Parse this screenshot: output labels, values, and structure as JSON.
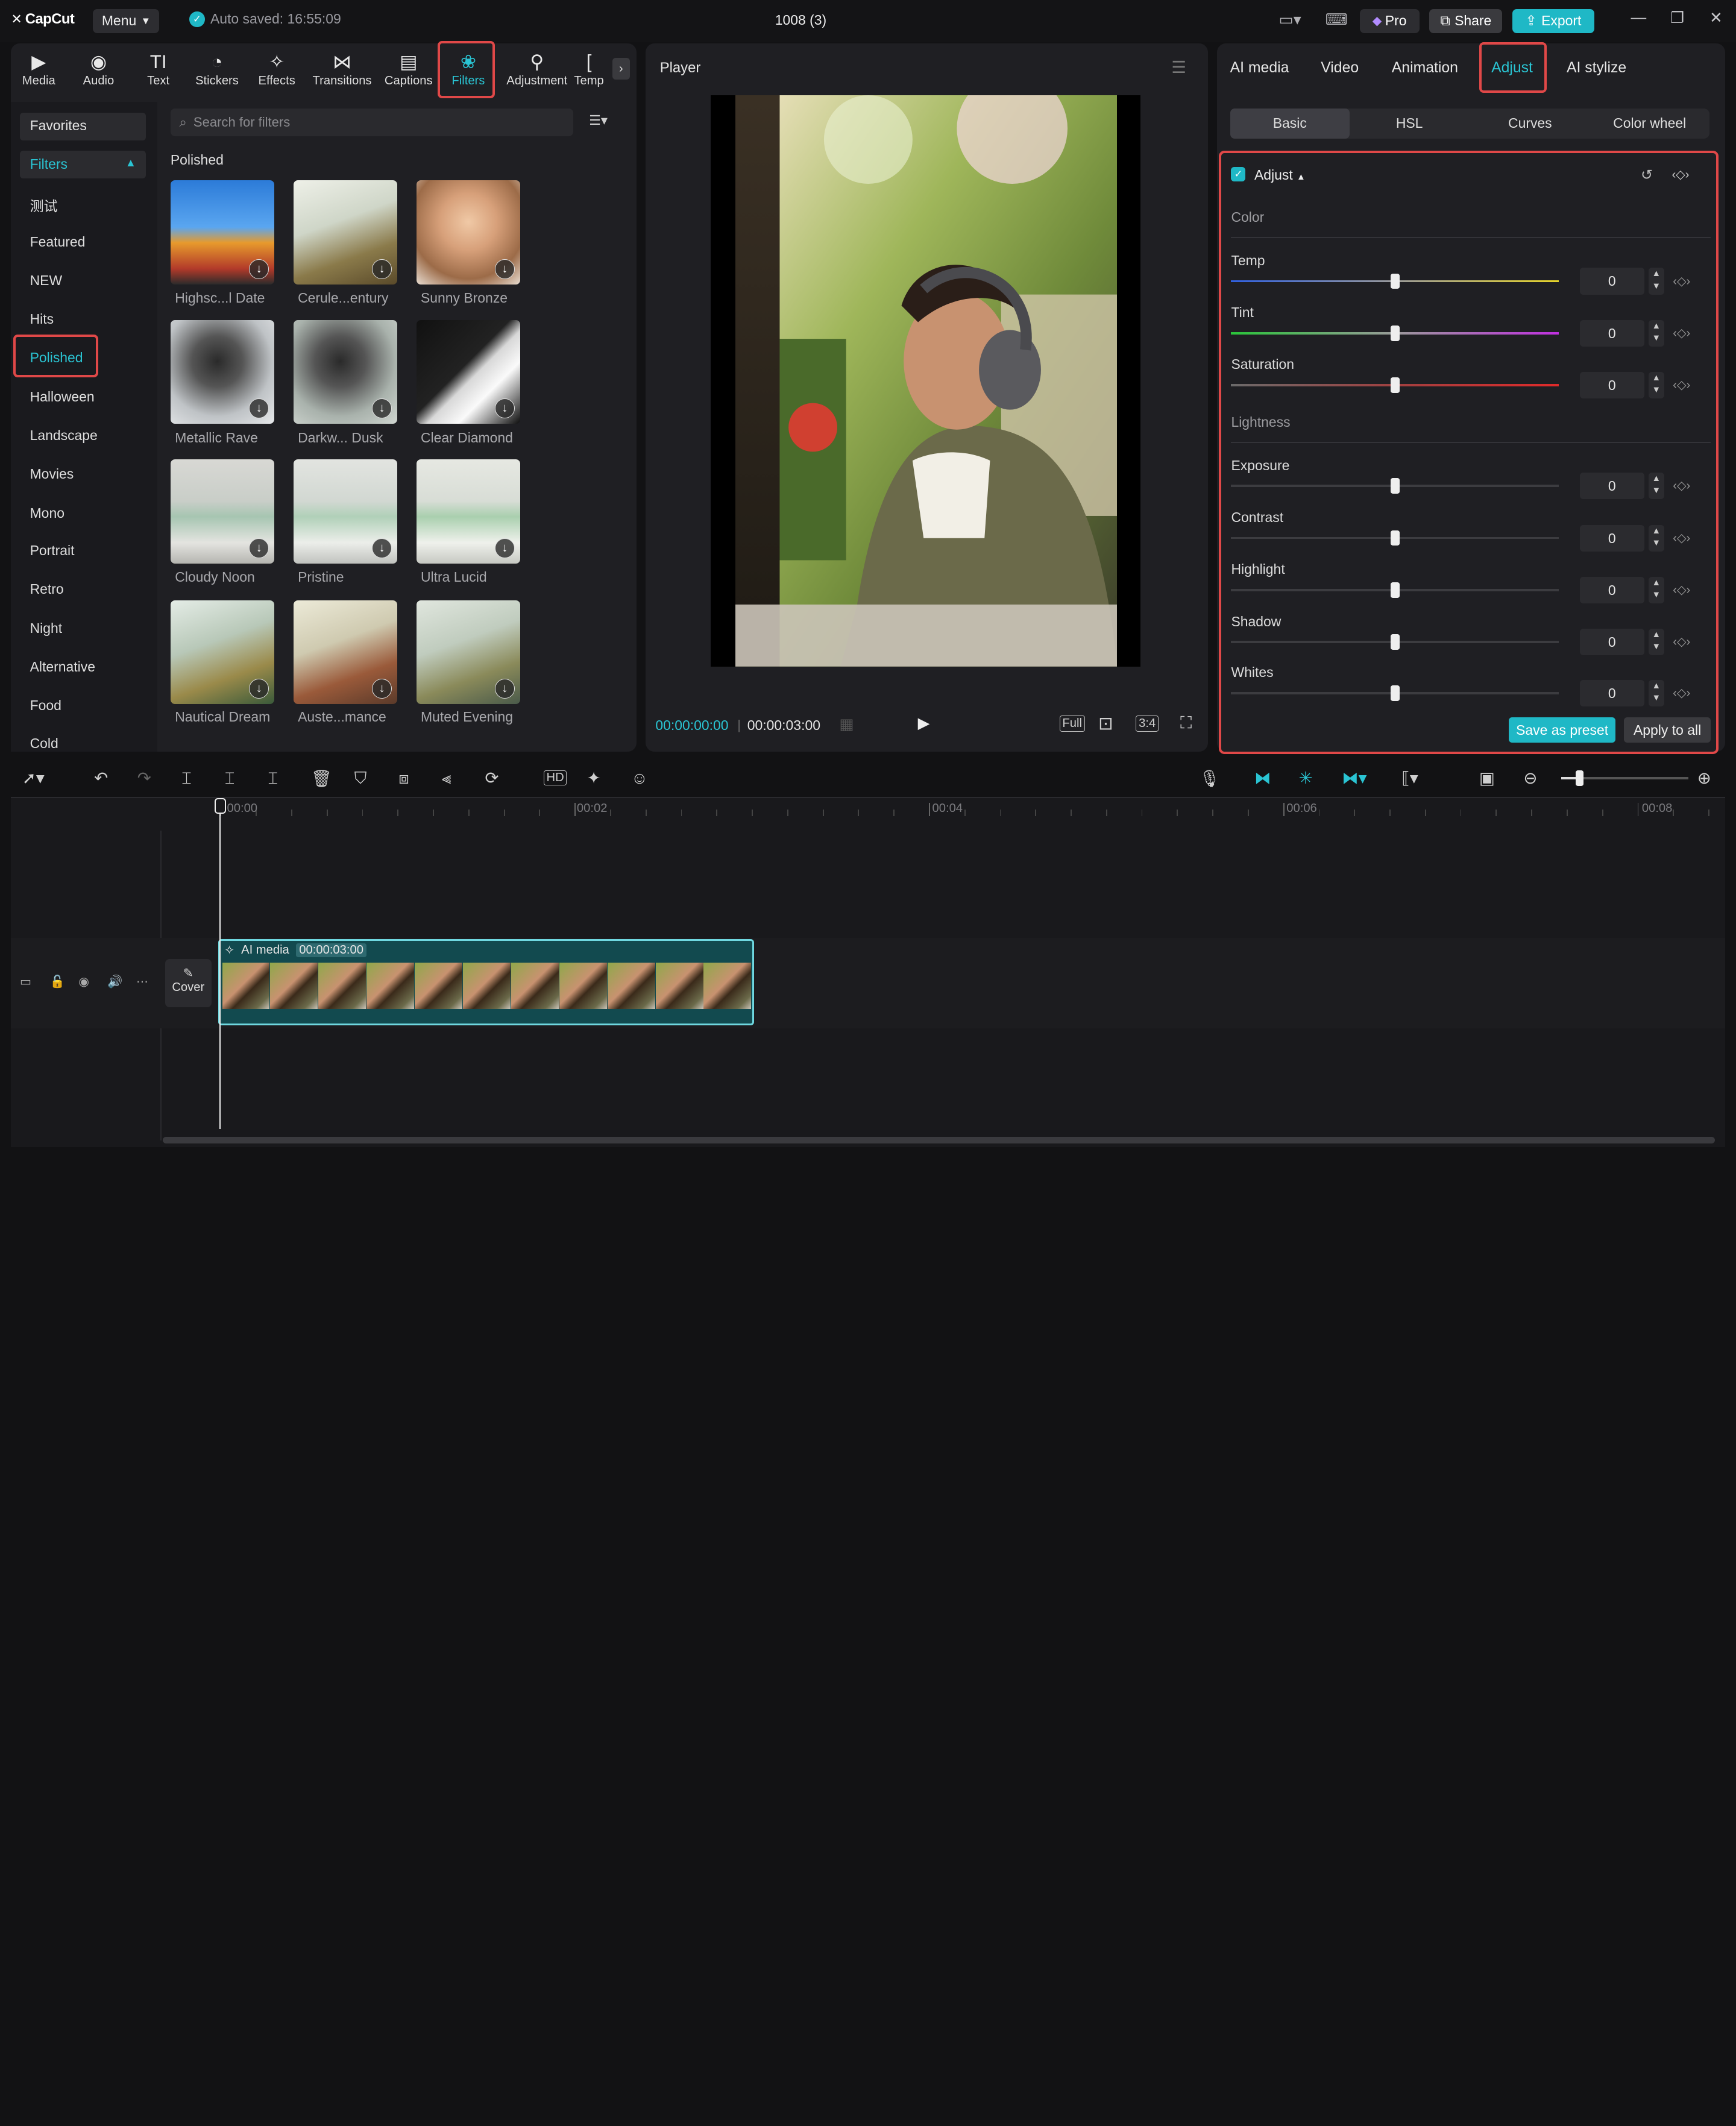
{
  "titlebar": {
    "brand": "CapCut",
    "menu": "Menu",
    "autosave": "Auto saved: 16:55:09",
    "doc_title": "1008 (3)",
    "pro": "Pro",
    "share": "Share",
    "export": "Export"
  },
  "media_tabs": [
    {
      "label": "Media",
      "icon": "media-icon"
    },
    {
      "label": "Audio",
      "icon": "audio-icon"
    },
    {
      "label": "Text",
      "icon": "text-icon"
    },
    {
      "label": "Stickers",
      "icon": "stickers-icon"
    },
    {
      "label": "Effects",
      "icon": "effects-icon"
    },
    {
      "label": "Transitions",
      "icon": "transitions-icon"
    },
    {
      "label": "Captions",
      "icon": "captions-icon"
    },
    {
      "label": "Filters",
      "icon": "filters-icon"
    },
    {
      "label": "Adjustment",
      "icon": "adjustment-icon"
    },
    {
      "label": "Temp",
      "icon": "template-icon"
    }
  ],
  "sidebar": {
    "favorites": "Favorites",
    "filters": "Filters",
    "items": [
      "测试",
      "Featured",
      "NEW",
      "Hits",
      "Polished",
      "Halloween",
      "Landscape",
      "Movies",
      "Mono",
      "Portrait",
      "Retro",
      "Night",
      "Alternative",
      "Food",
      "Cold"
    ]
  },
  "search": {
    "placeholder": "Search for filters"
  },
  "section_title": "Polished",
  "filters": [
    "Highsc...l Date",
    "Cerule...entury",
    "Sunny Bronze",
    "Metallic Rave",
    "Darkw... Dusk",
    "Clear Diamond",
    "Cloudy Noon",
    "Pristine",
    "Ultra Lucid",
    "Nautical Dream",
    "Auste...mance",
    "Muted Evening"
  ],
  "player": {
    "title": "Player",
    "current_time": "00:00:00:00",
    "duration": "00:00:03:00",
    "full": "Full",
    "ratio": "3:4"
  },
  "right_tabs": [
    "AI media",
    "Video",
    "Animation",
    "Adjust",
    "AI stylize"
  ],
  "sub_tabs": [
    "Basic",
    "HSL",
    "Curves",
    "Color wheel"
  ],
  "adjust": {
    "title": "Adjust",
    "color_group": "Color",
    "lightness_group": "Lightness",
    "color_params": [
      {
        "label": "Temp",
        "value": "0"
      },
      {
        "label": "Tint",
        "value": "0"
      },
      {
        "label": "Saturation",
        "value": "0"
      }
    ],
    "lightness_params": [
      {
        "label": "Exposure",
        "value": "0"
      },
      {
        "label": "Contrast",
        "value": "0"
      },
      {
        "label": "Highlight",
        "value": "0"
      },
      {
        "label": "Shadow",
        "value": "0"
      },
      {
        "label": "Whites",
        "value": "0"
      }
    ],
    "save_preset": "Save as preset",
    "apply_all": "Apply to all"
  },
  "timeline": {
    "ticks": [
      "00:00",
      "00:02",
      "00:04",
      "00:06",
      "00:08"
    ],
    "cover": "Cover",
    "clip_name": "AI media",
    "clip_duration": "00:00:03:00"
  },
  "colors": {
    "accent": "#1fb8c6",
    "highlight_box": "#e04848"
  }
}
